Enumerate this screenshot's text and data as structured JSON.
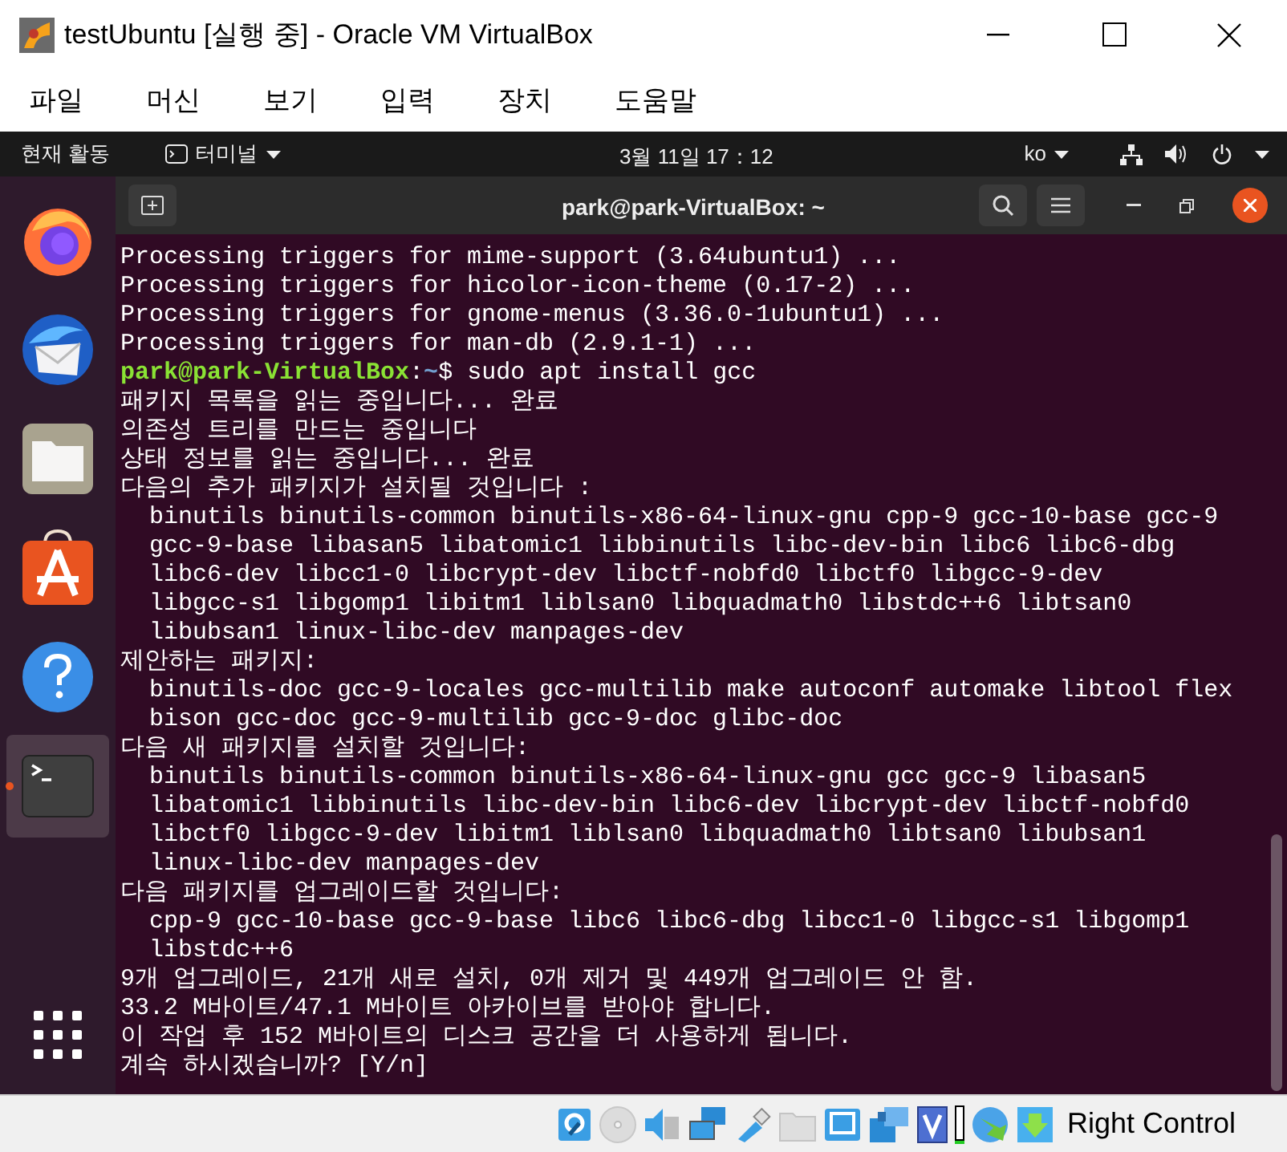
{
  "window": {
    "title": "testUbuntu [실행 중] - Oracle VM VirtualBox"
  },
  "menu": [
    "파일",
    "머신",
    "보기",
    "입력",
    "장치",
    "도움말"
  ],
  "top_bar": {
    "activities": "현재 활동",
    "app": "터미널",
    "clock": "3월 11일 17：12",
    "input_method": "ko"
  },
  "dock": [
    {
      "kind": "firefox",
      "selected": false,
      "running": false
    },
    {
      "kind": "thunderbird",
      "selected": false,
      "running": false
    },
    {
      "kind": "files",
      "selected": false,
      "running": false
    },
    {
      "kind": "software",
      "selected": false,
      "running": false
    },
    {
      "kind": "help",
      "selected": false,
      "running": false
    },
    {
      "kind": "terminal",
      "selected": true,
      "running": true
    }
  ],
  "terminal": {
    "title": "park@park-VirtualBox: ~",
    "lines": [
      {
        "kind": "output",
        "text": "Processing triggers for mime-support (3.64ubuntu1) ..."
      },
      {
        "kind": "output",
        "text": "Processing triggers for hicolor-icon-theme (0.17-2) ..."
      },
      {
        "kind": "output",
        "text": "Processing triggers for gnome-menus (3.36.0-1ubuntu1) ..."
      },
      {
        "kind": "output",
        "text": "Processing triggers for man-db (2.9.1-1) ..."
      },
      {
        "kind": "prompt",
        "user": "park@park-VirtualBox",
        "sep": ":",
        "path": "~",
        "text": "$ sudo apt install gcc"
      },
      {
        "kind": "output",
        "text": "패키지 목록을 읽는 중입니다... 완료"
      },
      {
        "kind": "output",
        "text": "의존성 트리를 만드는 중입니다"
      },
      {
        "kind": "output",
        "text": "상태 정보를 읽는 중입니다... 완료"
      },
      {
        "kind": "output",
        "text": "다음의 추가 패키지가 설치될 것입니다 :"
      },
      {
        "kind": "package",
        "text": "binutils binutils-common binutils-x86-64-linux-gnu cpp-9 gcc-10-base gcc-9"
      },
      {
        "kind": "package",
        "text": "gcc-9-base libasan5 libatomic1 libbinutils libc-dev-bin libc6 libc6-dbg"
      },
      {
        "kind": "package",
        "text": "libc6-dev libcc1-0 libcrypt-dev libctf-nobfd0 libctf0 libgcc-9-dev"
      },
      {
        "kind": "package",
        "text": "libgcc-s1 libgomp1 libitm1 liblsan0 libquadmath0 libstdc++6 libtsan0"
      },
      {
        "kind": "package",
        "text": "libubsan1 linux-libc-dev manpages-dev"
      },
      {
        "kind": "output",
        "text": "제안하는 패키지:"
      },
      {
        "kind": "package",
        "text": "binutils-doc gcc-9-locales gcc-multilib make autoconf automake libtool flex"
      },
      {
        "kind": "package",
        "text": "bison gcc-doc gcc-9-multilib gcc-9-doc glibc-doc"
      },
      {
        "kind": "output",
        "text": "다음 새 패키지를 설치할 것입니다:"
      },
      {
        "kind": "package",
        "text": "binutils binutils-common binutils-x86-64-linux-gnu gcc gcc-9 libasan5"
      },
      {
        "kind": "package",
        "text": "libatomic1 libbinutils libc-dev-bin libc6-dev libcrypt-dev libctf-nobfd0"
      },
      {
        "kind": "package",
        "text": "libctf0 libgcc-9-dev libitm1 liblsan0 libquadmath0 libtsan0 libubsan1"
      },
      {
        "kind": "package",
        "text": "linux-libc-dev manpages-dev"
      },
      {
        "kind": "output",
        "text": "다음 패키지를 업그레이드할 것입니다:"
      },
      {
        "kind": "package",
        "text": "cpp-9 gcc-10-base gcc-9-base libc6 libc6-dbg libcc1-0 libgcc-s1 libgomp1"
      },
      {
        "kind": "package",
        "text": "libstdc++6"
      },
      {
        "kind": "output",
        "text": "9개 업그레이드, 21개 새로 설치, 0개 제거 및 449개 업그레이드 안 함."
      },
      {
        "kind": "output",
        "text": "33.2 M바이트/47.1 M바이트 아카이브를 받아야 합니다."
      },
      {
        "kind": "output",
        "text": "이 작업 후 152 M바이트의 디스크 공간을 더 사용하게 됩니다."
      },
      {
        "kind": "output",
        "text": "계속 하시겠습니까? [Y/n]"
      }
    ]
  },
  "status_bar": {
    "host_key": "Right Control"
  }
}
